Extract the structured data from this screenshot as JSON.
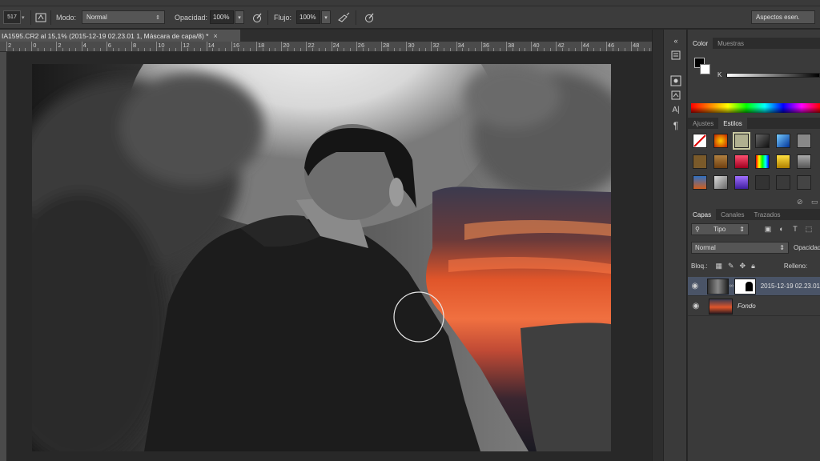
{
  "options_bar": {
    "brush_size": "517",
    "mode_label": "Modo:",
    "mode_value": "Normal",
    "opacity_label": "Opacidad:",
    "opacity_value": "100%",
    "flow_label": "Flujo:",
    "flow_value": "100%",
    "workspace_label": "Aspectos esen."
  },
  "document": {
    "tab_title": "IA1595.CR2 al 15,1% (2015-12-19 02.23.01 1, Máscara de capa/8) *",
    "close_glyph": "×"
  },
  "ruler": {
    "labels": [
      "2",
      "0",
      "2",
      "4",
      "6",
      "8",
      "10",
      "12",
      "14",
      "16",
      "18",
      "20",
      "22",
      "24",
      "26",
      "28",
      "30",
      "32",
      "34",
      "36",
      "38",
      "40",
      "42",
      "44",
      "46",
      "48",
      "50"
    ]
  },
  "color_panel": {
    "tabs": [
      "Color",
      "Muestras"
    ],
    "active_tab": "Color",
    "channel_label": "K"
  },
  "styles_panel": {
    "tabs": [
      "Ajustes",
      "Estilos"
    ],
    "active_tab": "Estilos"
  },
  "layers_panel": {
    "tabs": [
      "Capas",
      "Canales",
      "Trazados"
    ],
    "active_tab": "Capas",
    "filter_label": "Tipo",
    "blend_mode": "Normal",
    "opacity_label": "Opacidad:",
    "lock_label": "Bloq.:",
    "fill_label": "Relleno:",
    "layers": [
      {
        "name": "2015-12-19 02.23.01",
        "active": true,
        "has_mask": true
      },
      {
        "name": "Fondo",
        "active": false,
        "has_mask": false
      }
    ]
  },
  "icons": {
    "brush_tool": "brush-icon",
    "toggle_brush_panel": "brush-panel-icon",
    "pressure_opacity": "pen-pressure-icon",
    "airbrush": "airbrush-icon",
    "pressure_size": "pen-pressure-size-icon"
  },
  "colors": {
    "ui_background": "#3a3a3a",
    "active_layer": "#4a5467",
    "foreground": "#000000",
    "background": "#ffffff",
    "sunset_orange": "#e0552a"
  }
}
